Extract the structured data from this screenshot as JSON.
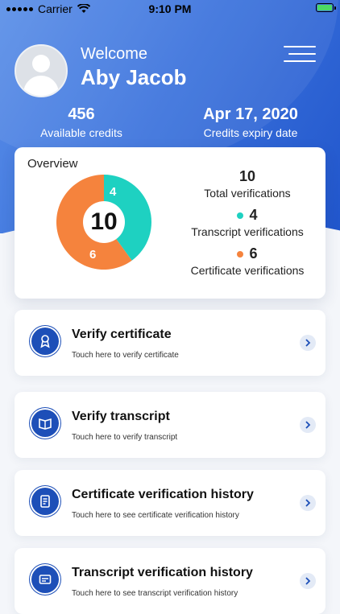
{
  "status_bar": {
    "carrier": "Carrier",
    "time": "9:10 PM"
  },
  "header": {
    "welcome": "Welcome",
    "user_name": "Aby Jacob",
    "credits_value": "456",
    "credits_label": "Available credits",
    "expiry_value": "Apr 17, 2020",
    "expiry_label": "Credits expiry date"
  },
  "overview": {
    "title": "Overview",
    "total_value": "10",
    "total_label": "Total verifications",
    "transcript_value": "4",
    "transcript_label": "Transcript verifications",
    "certificate_value": "6",
    "certificate_label": "Certificate verifications",
    "donut_center": "10",
    "donut_transcript": "4",
    "donut_certificate": "6"
  },
  "colors": {
    "teal": "#1ed1c1",
    "orange": "#f5833d",
    "brand_blue": "#1d4fb8"
  },
  "actions": [
    {
      "title": "Verify certificate",
      "subtitle": "Touch here to verify certificate",
      "icon": "certificate-icon"
    },
    {
      "title": "Verify transcript",
      "subtitle": "Touch here to verify transcript",
      "icon": "transcript-icon"
    },
    {
      "title": "Certificate verification history",
      "subtitle": "Touch here to see certificate verification history",
      "icon": "certificate-history-icon"
    },
    {
      "title": "Transcript verification history",
      "subtitle": "Touch here to see transcript verification history",
      "icon": "transcript-history-icon"
    }
  ]
}
